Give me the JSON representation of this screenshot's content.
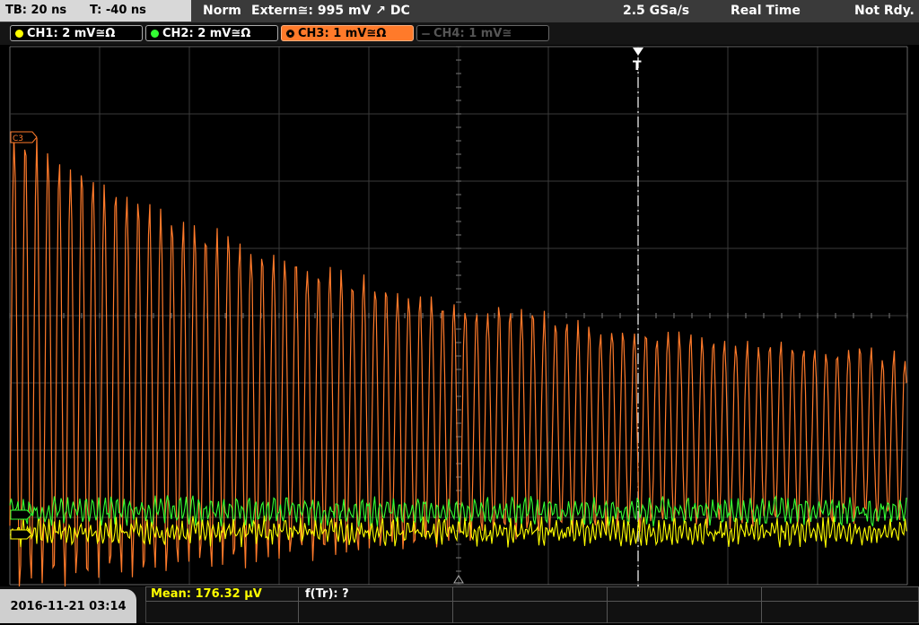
{
  "topbar": {
    "timebase": "TB: 20 ns",
    "trigger_time": "T: -40 ns",
    "mode": "Norm",
    "trigger": "Extern≅: 995 mV ↗ DC",
    "sample_rate": "2.5 GSa/s",
    "acq_mode": "Real Time",
    "status": "Not Rdy."
  },
  "channels": [
    {
      "label": "CH1: 2 mV≅Ω",
      "color": "#ffff00",
      "state": "on"
    },
    {
      "label": "CH2: 2 mV≅Ω",
      "color": "#33ff33",
      "state": "on"
    },
    {
      "label": "CH3: 1 mV≅Ω",
      "color": "#ff7a2a",
      "state": "active"
    },
    {
      "label": "CH4: 1 mV≅",
      "color": "#666666",
      "state": "off"
    }
  ],
  "screen": {
    "ch3_marker": "C3",
    "trigger_marker": "T"
  },
  "bottombar": {
    "datetime": "2016-11-21 03:14",
    "mean": "Mean: 176.32 µV",
    "freq": "f(Tr): ?"
  },
  "colors": {
    "ch1": "#ffff00",
    "ch2": "#33ff33",
    "ch3": "#ff7a2a",
    "grid": "#444444"
  }
}
